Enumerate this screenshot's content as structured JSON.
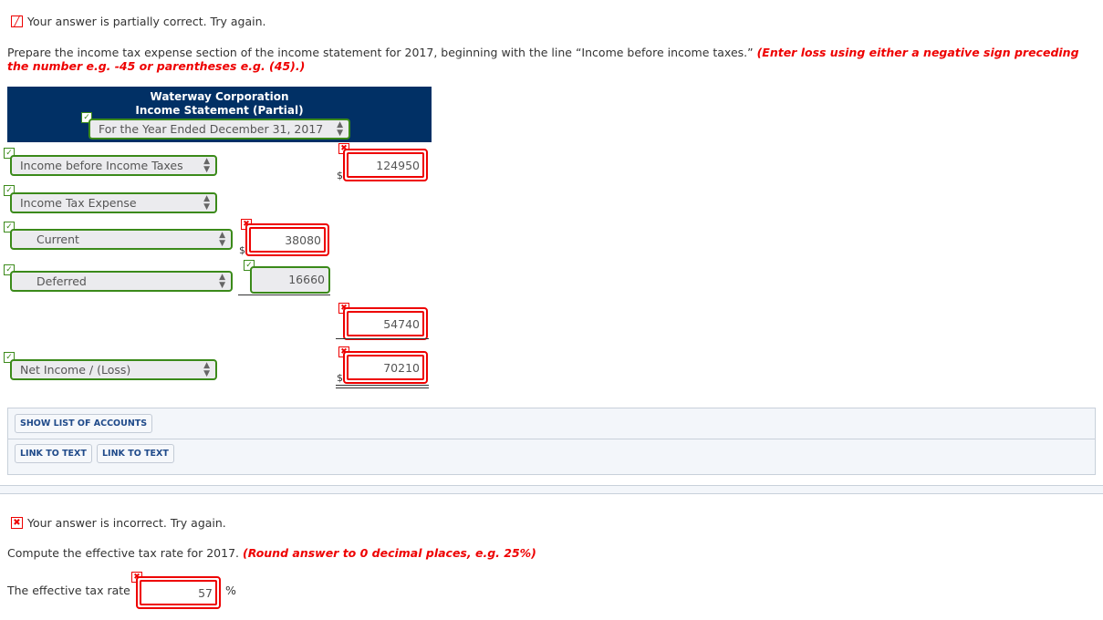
{
  "part1": {
    "status": {
      "icon": "pencil-partial-icon",
      "text": "Your answer is partially correct.  Try again."
    },
    "question": {
      "text": "Prepare the income tax expense section of the income statement for 2017, beginning with the line “Income before income taxes.” ",
      "hint": "(Enter loss using either a negative sign preceding the number e.g. -45 or parentheses e.g. (45).)"
    },
    "statement_header": {
      "company": "Waterway Corporation",
      "title": "Income Statement (Partial)",
      "period": "For the Year Ended December 31, 2017",
      "period_status": "correct"
    },
    "rows": [
      {
        "label": "Income before Income Taxes",
        "label_status": "correct",
        "amount": "124950",
        "amount_status": "incorrect",
        "column": "outer",
        "dollar": "$"
      },
      {
        "label": "Income Tax Expense",
        "label_status": "correct"
      },
      {
        "label": "Current",
        "label_status": "correct",
        "amount": "38080",
        "amount_status": "incorrect",
        "column": "inner",
        "dollar": "$"
      },
      {
        "label": "Deferred",
        "label_status": "correct",
        "amount": "16660",
        "amount_status": "correct",
        "column": "inner"
      },
      {
        "amount": "54740",
        "amount_status": "incorrect",
        "column": "outer"
      },
      {
        "label": "Net Income / (Loss)",
        "label_status": "correct",
        "amount": "70210",
        "amount_status": "incorrect",
        "column": "outer",
        "dollar": "$"
      }
    ],
    "buttons": {
      "show_accounts": "SHOW LIST OF ACCOUNTS",
      "link1": "LINK TO TEXT",
      "link2": "LINK TO TEXT"
    }
  },
  "part2": {
    "status": {
      "icon": "x-incorrect-icon",
      "text": "Your answer is incorrect.  Try again."
    },
    "question": {
      "text": "Compute the effective tax rate for 2017. ",
      "hint": "(Round answer to 0 decimal places, e.g. 25%)"
    },
    "field_label": "The effective tax rate",
    "field_value": "57",
    "field_status": "incorrect",
    "unit": "%"
  },
  "glyphs": {
    "check": "✓",
    "cross": "✖",
    "pencil": "╱",
    "updown": "▲▼"
  },
  "colors": {
    "header_bg": "#013065",
    "correct": "#3b8a1a",
    "incorrect": "#ee0000"
  }
}
